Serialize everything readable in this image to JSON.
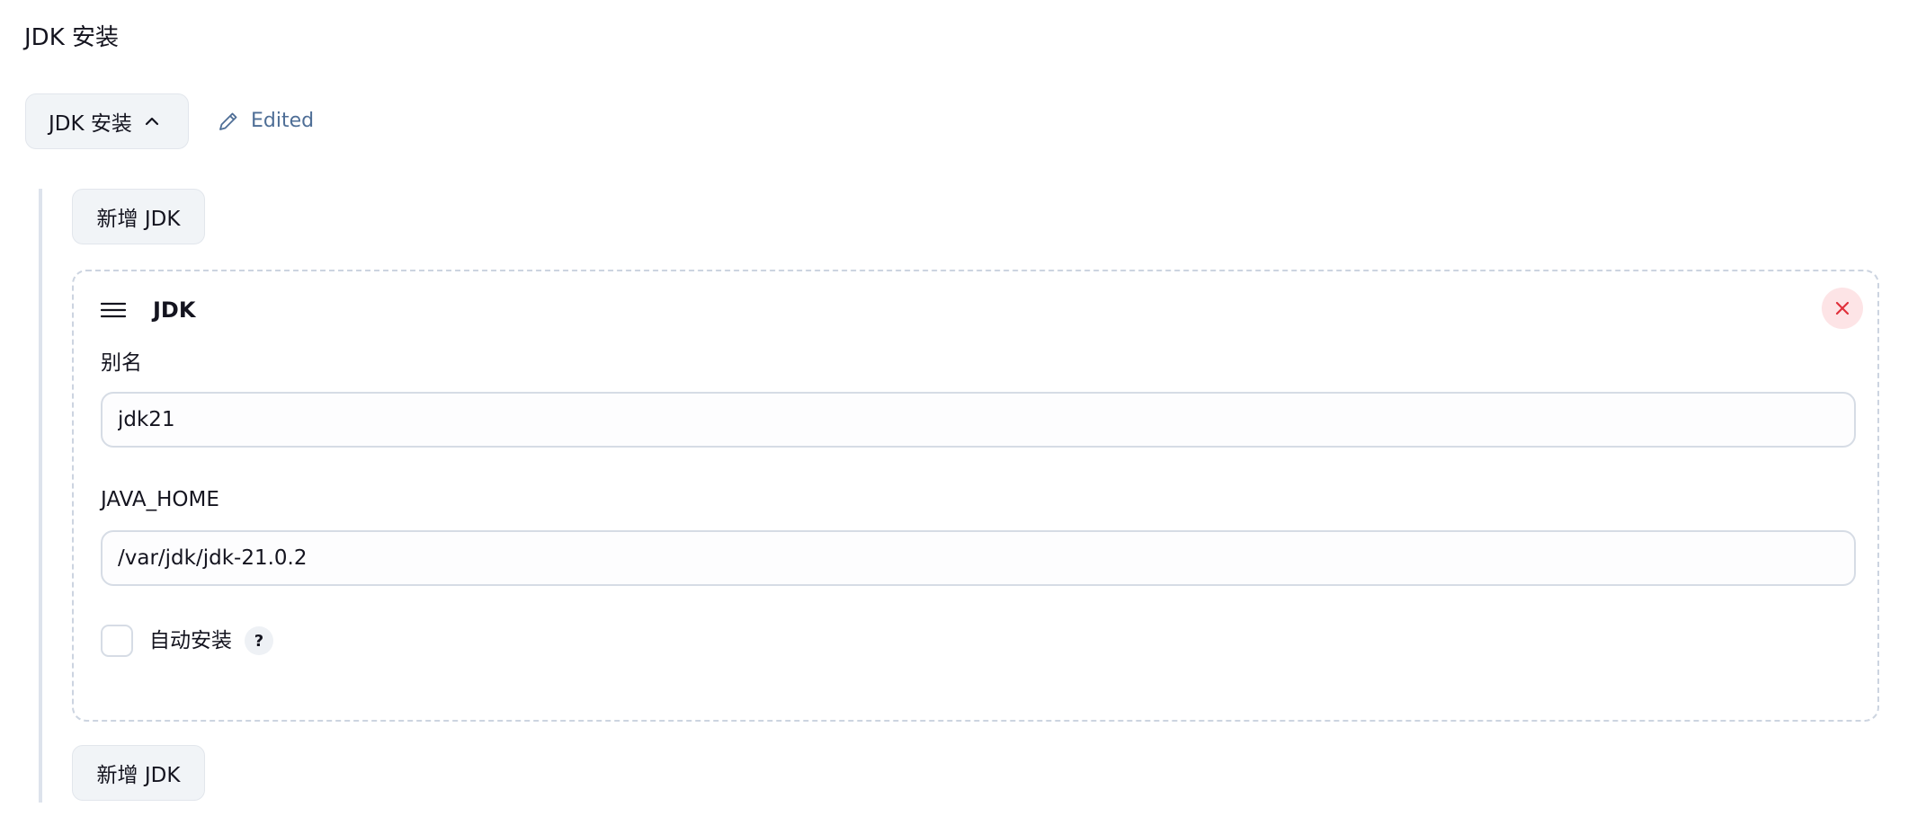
{
  "section": {
    "title": "JDK 安装"
  },
  "toggle": {
    "label": "JDK 安装",
    "icon": "chevron-up-icon"
  },
  "status": {
    "label": "Edited",
    "icon": "pencil-icon",
    "color": "#4e6e96"
  },
  "add_button": {
    "label": "新增 JDK"
  },
  "card": {
    "title": "JDK",
    "drag_icon": "drag-handle-icon",
    "close_icon": "close-icon",
    "fields": {
      "alias": {
        "label": "别名",
        "value": "jdk21"
      },
      "java_home": {
        "label": "JAVA_HOME",
        "value": "/var/jdk/jdk-21.0.2"
      }
    },
    "auto_install": {
      "label": "自动安装",
      "checked": false,
      "help": "?"
    }
  },
  "colors": {
    "button_bg": "#f1f4f7",
    "close_bg": "#fde4e6",
    "close_icon": "#e0303b",
    "border": "#ccd4e0"
  }
}
